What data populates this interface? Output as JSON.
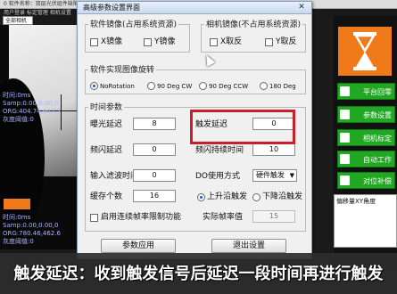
{
  "app": {
    "top_text": "0  软件名称：双层光伏组件缺陷",
    "menu": "用户登录  标定管理  相机设置",
    "camera_select": "全部相机",
    "overlay_top": "时间:0ms\nSamp:0.00,0.00,0\nORG:404.74,647.7\n灰度阈值:0",
    "overlay_bottom": "时间:0ms\nSamp:0.00,0.00,0\nORG:780.46,462.6\n灰度阈值:0"
  },
  "sidebar": {
    "buttons": [
      "平台回零",
      "参数设置",
      "相机标定",
      "自动工作",
      "对位补偿"
    ],
    "offset_label": "偏移量XY角度"
  },
  "dialog": {
    "title": "高级参数设置界面",
    "close": "✕",
    "software_mirror": {
      "title": "软件镜像(占用系统资源)",
      "x": "X镜像",
      "y": "Y镜像"
    },
    "camera_mirror": {
      "title": "相机镜像(不占用系统资源)",
      "x": "X取反",
      "y": "Y取反"
    },
    "rotation": {
      "title": "软件实现图像旋转",
      "options": [
        "NoRotation",
        "90 Deg CW",
        "90 Deg CCW",
        "180 Deg"
      ],
      "selected": 0
    },
    "timing": {
      "title": "时间参数",
      "exposure_delay_label": "曝光延迟",
      "exposure_delay": "8",
      "trigger_delay_label": "触发延迟",
      "trigger_delay": "0",
      "flash_delay_label": "频闪延迟",
      "flash_delay": "0",
      "strobe_duration_label": "频闪持续时间",
      "strobe_duration": "10",
      "input_filter_label": "输入滤波时间",
      "input_filter": "0",
      "do_mode_label": "DO使用方式",
      "do_mode": "硬件触发",
      "buffer_label": "缓存个数",
      "buffer": "16",
      "rising_edge": "上升沿触发",
      "falling_edge": "下降沿触发",
      "continuous_label": "启用连续帧率限制功能",
      "actual_fps_label": "实际帧率值",
      "actual_fps": "15"
    },
    "apply_button": "参数应用",
    "exit_button": "退出设置"
  },
  "subtitle": "触发延迟：收到触发信号后延迟一段时间再进行触发",
  "colors": {
    "highlight": "#c8202a",
    "accent_orange": "#f07a1a",
    "side_button": "#22a722"
  }
}
